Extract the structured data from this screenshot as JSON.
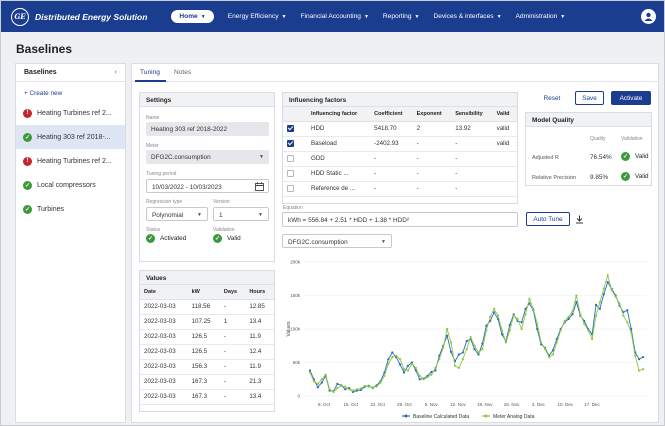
{
  "app": {
    "title": "Distributed Energy Solution",
    "logo": "GE"
  },
  "nav": [
    {
      "label": "Home",
      "active": true
    },
    {
      "label": "Energy Efficiency",
      "active": false
    },
    {
      "label": "Financial Accounting",
      "active": false
    },
    {
      "label": "Reporting",
      "active": false
    },
    {
      "label": "Devices & interfaces",
      "active": false
    },
    {
      "label": "Administration",
      "active": false
    }
  ],
  "page": {
    "title": "Baselines"
  },
  "sidebar": {
    "title": "Baselines",
    "create_label": "+ Create new",
    "items": [
      {
        "label": "Heating Turbines ref 2...",
        "status": "error"
      },
      {
        "label": "Heating 303 ref 2018-...",
        "status": "ok",
        "selected": true
      },
      {
        "label": "Heating Turbines ref 2...",
        "status": "error"
      },
      {
        "label": "Local compressors",
        "status": "ok"
      },
      {
        "label": "Turbines",
        "status": "ok"
      }
    ]
  },
  "tabs": [
    {
      "label": "Tuning",
      "active": true
    },
    {
      "label": "Notes",
      "active": false
    }
  ],
  "settings": {
    "title": "Settings",
    "name_label": "Name",
    "name_value": "Heating 303 ref 2018-2022",
    "meter_label": "Meter",
    "meter_value": "DFG2C.consumption",
    "period_label": "Tuning period",
    "period_value": "10/03/2022 - 10/03/2023",
    "regtype_label": "Regression type",
    "regtype_value": "Polynomial",
    "version_label": "Version",
    "version_value": "1",
    "status_label": "Status",
    "status_value": "Activated",
    "validation_label": "Validation",
    "validation_value": "Valid"
  },
  "values_panel": {
    "title": "Values",
    "headers": [
      "Date",
      "kW",
      "Days",
      "Hours"
    ],
    "rows": [
      [
        "2022-03-03",
        "118.56",
        "-",
        "12.85"
      ],
      [
        "2022-03-03",
        "107.25",
        "1",
        "13.4"
      ],
      [
        "2022-03-03",
        "126.5",
        "-",
        "11.9"
      ],
      [
        "2022-03-03",
        "126.5",
        "-",
        "12.4"
      ],
      [
        "2022-03-03",
        "156.3",
        "-",
        "11.9"
      ],
      [
        "2022-03-03",
        "167.3",
        "-",
        "21.3"
      ],
      [
        "2022-03-03",
        "167.3",
        "-",
        "13.4"
      ]
    ]
  },
  "factors": {
    "title": "Influencing factors",
    "headers": [
      "Influencing factor",
      "Coefficient",
      "Exponent",
      "Sensibility",
      "Valid"
    ],
    "rows": [
      {
        "checked": true,
        "name": "HDD",
        "coef": "5418.70",
        "exp": "2",
        "sens": "13.92",
        "valid": "valid"
      },
      {
        "checked": true,
        "name": "Baseload",
        "coef": "-2402.93",
        "exp": "-",
        "sens": "-",
        "valid": "valid"
      },
      {
        "checked": false,
        "name": "GDD",
        "coef": "-",
        "exp": "-",
        "sens": "-",
        "valid": ""
      },
      {
        "checked": false,
        "name": "HDD Static ...",
        "coef": "-",
        "exp": "-",
        "sens": "-",
        "valid": ""
      },
      {
        "checked": false,
        "name": "Reference de ...",
        "coef": "-",
        "exp": "-",
        "sens": "-",
        "valid": ""
      }
    ]
  },
  "equation": {
    "label": "Equation",
    "value": "kWh = 556.84 + 2.51 * HDD + 1.38 * HDD²",
    "autotune_label": "Auto Tune"
  },
  "meter_select": "DFG2C.consumption",
  "actions": {
    "reset": "Reset",
    "save": "Save",
    "activate": "Activate"
  },
  "model_quality": {
    "title": "Model Quality",
    "headers": [
      "Quality",
      "Validation"
    ],
    "rows": [
      {
        "label": "Adjusted R",
        "quality": "76.54%",
        "validation": "Valid"
      },
      {
        "label": "Relative Precision",
        "quality": "9.85%",
        "validation": "Valid"
      }
    ]
  },
  "colors": {
    "brand": "#1b3d8f",
    "ok": "#3d9a3c",
    "error": "#c4262e",
    "baseline": "#2b6cb8",
    "meter": "#8cc63e"
  },
  "chart_data": {
    "type": "line",
    "ylabel": "Values",
    "yticks": [
      "0",
      "50k",
      "100k",
      "150k",
      "200k"
    ],
    "ylim": [
      0,
      200000
    ],
    "xticks": [
      "8. Oct",
      "15. Oct",
      "22. Oct",
      "29. Oct",
      "5. Nov",
      "12. Nov",
      "19. Nov",
      "26. Nov",
      "3. Dec",
      "10. Dec",
      "17. Dec"
    ],
    "legend_position": "bottom",
    "series": [
      {
        "name": "Baseline Calculated Data",
        "color": "#2b6cb8",
        "values": [
          38000,
          25000,
          13000,
          20000,
          30000,
          8000,
          7000,
          18000,
          16000,
          10000,
          12000,
          6000,
          8000,
          9000,
          14000,
          15000,
          12000,
          16000,
          22000,
          35000,
          55000,
          65000,
          58000,
          47000,
          35000,
          45000,
          50000,
          38000,
          25000,
          26000,
          30000,
          36000,
          38000,
          60000,
          75000,
          90000,
          66000,
          52000,
          62000,
          65000,
          82000,
          85000,
          70000,
          62000,
          78000,
          105000,
          112000,
          125000,
          115000,
          92000,
          82000,
          106000,
          122000,
          112000,
          110000,
          130000,
          138000,
          128000,
          100000,
          77000,
          72000,
          60000,
          68000,
          85000,
          100000,
          110000,
          115000,
          122000,
          140000,
          120000,
          112000,
          100000,
          92000,
          136000,
          130000,
          152000,
          170000,
          160000,
          150000,
          135000,
          125000,
          128000,
          100000,
          65000,
          55000,
          58000
        ]
      },
      {
        "name": "Meter Analog Data",
        "color": "#8cc63e",
        "values": [
          35000,
          22000,
          18000,
          25000,
          32000,
          10000,
          6000,
          12000,
          15000,
          14000,
          10000,
          8000,
          10000,
          11000,
          15000,
          14000,
          13000,
          14000,
          20000,
          30000,
          48000,
          58000,
          60000,
          55000,
          40000,
          38000,
          48000,
          42000,
          30000,
          25000,
          28000,
          32000,
          42000,
          55000,
          72000,
          100000,
          80000,
          45000,
          42000,
          55000,
          70000,
          88000,
          75000,
          65000,
          70000,
          98000,
          118000,
          130000,
          120000,
          98000,
          80000,
          98000,
          120000,
          115000,
          100000,
          122000,
          145000,
          130000,
          108000,
          80000,
          70000,
          58000,
          62000,
          80000,
          98000,
          112000,
          118000,
          126000,
          150000,
          122000,
          108000,
          98000,
          85000,
          120000,
          140000,
          160000,
          180000,
          158000,
          148000,
          138000,
          120000,
          110000,
          95000,
          60000,
          38000,
          40000
        ]
      }
    ]
  }
}
